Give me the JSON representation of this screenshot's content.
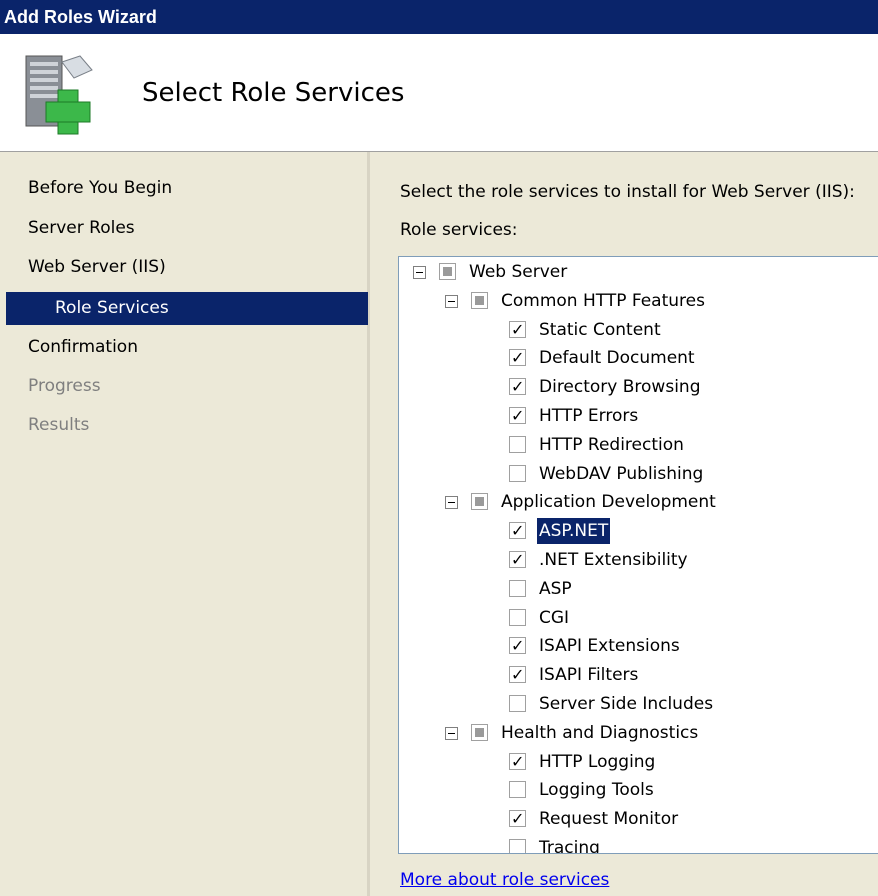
{
  "window": {
    "title": "Add Roles Wizard"
  },
  "header": {
    "title": "Select Role Services",
    "icon": "server-add-icon"
  },
  "nav": {
    "items": [
      {
        "label": "Before You Begin",
        "state": "normal"
      },
      {
        "label": "Server Roles",
        "state": "normal"
      },
      {
        "label": "Web Server (IIS)",
        "state": "normal"
      },
      {
        "label": "Role Services",
        "state": "selected"
      },
      {
        "label": "Confirmation",
        "state": "normal"
      },
      {
        "label": "Progress",
        "state": "disabled"
      },
      {
        "label": "Results",
        "state": "disabled"
      }
    ]
  },
  "content": {
    "instruction": "Select the role services to install for Web Server (IIS):",
    "role_services_label": "Role services:",
    "more_link": "More about role services"
  },
  "tree": [
    {
      "label": "Web Server",
      "level": 0,
      "expander": true,
      "state": "partial"
    },
    {
      "label": "Common HTTP Features",
      "level": 1,
      "expander": true,
      "state": "partial"
    },
    {
      "label": "Static Content",
      "level": 2,
      "state": "checked"
    },
    {
      "label": "Default Document",
      "level": 2,
      "state": "checked"
    },
    {
      "label": "Directory Browsing",
      "level": 2,
      "state": "checked"
    },
    {
      "label": "HTTP Errors",
      "level": 2,
      "state": "checked"
    },
    {
      "label": "HTTP Redirection",
      "level": 2,
      "state": "unchecked"
    },
    {
      "label": "WebDAV Publishing",
      "level": 2,
      "state": "unchecked"
    },
    {
      "label": "Application Development",
      "level": 1,
      "expander": true,
      "state": "partial"
    },
    {
      "label": "ASP.NET",
      "level": 2,
      "state": "checked",
      "selected": true
    },
    {
      "label": ".NET Extensibility",
      "level": 2,
      "state": "checked"
    },
    {
      "label": "ASP",
      "level": 2,
      "state": "unchecked"
    },
    {
      "label": "CGI",
      "level": 2,
      "state": "unchecked"
    },
    {
      "label": "ISAPI Extensions",
      "level": 2,
      "state": "checked"
    },
    {
      "label": "ISAPI Filters",
      "level": 2,
      "state": "checked"
    },
    {
      "label": "Server Side Includes",
      "level": 2,
      "state": "unchecked"
    },
    {
      "label": "Health and Diagnostics",
      "level": 1,
      "expander": true,
      "state": "partial"
    },
    {
      "label": "HTTP Logging",
      "level": 2,
      "state": "checked"
    },
    {
      "label": "Logging Tools",
      "level": 2,
      "state": "unchecked"
    },
    {
      "label": "Request Monitor",
      "level": 2,
      "state": "checked"
    },
    {
      "label": "Tracing",
      "level": 2,
      "state": "unchecked"
    }
  ]
}
